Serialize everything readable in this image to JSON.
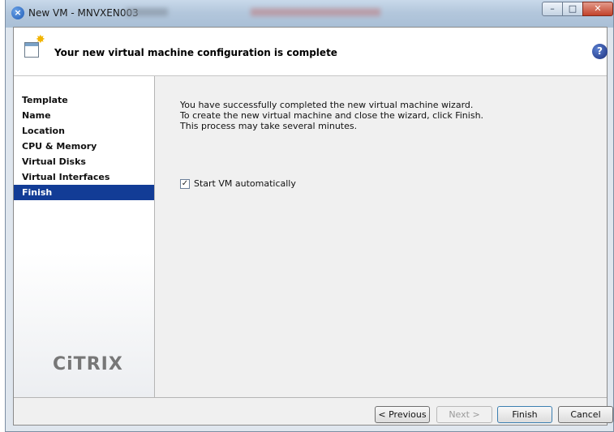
{
  "window": {
    "title": "New VM - MNVXEN003"
  },
  "header": {
    "title": "Your new virtual machine configuration is complete"
  },
  "sidebar": {
    "steps": [
      {
        "label": "Template"
      },
      {
        "label": "Name"
      },
      {
        "label": "Location"
      },
      {
        "label": "CPU & Memory"
      },
      {
        "label": "Virtual Disks"
      },
      {
        "label": "Virtual Interfaces"
      },
      {
        "label": "Finish",
        "active": true
      }
    ],
    "logo": "CiTRIX"
  },
  "content": {
    "lines": [
      "You have successfully completed the new virtual machine wizard.",
      "To create the new virtual machine and close the wizard, click Finish.",
      "This process may take several minutes."
    ],
    "start_vm": {
      "label": "Start VM automatically",
      "checked": true
    }
  },
  "buttons": {
    "previous": "< Previous",
    "next": "Next >",
    "finish": "Finish",
    "cancel": "Cancel"
  },
  "icons": {
    "app": "xen-app-icon",
    "header": "new-vm-wizard-icon",
    "help": "help-icon"
  },
  "colors": {
    "selected_step": "#123c96"
  }
}
